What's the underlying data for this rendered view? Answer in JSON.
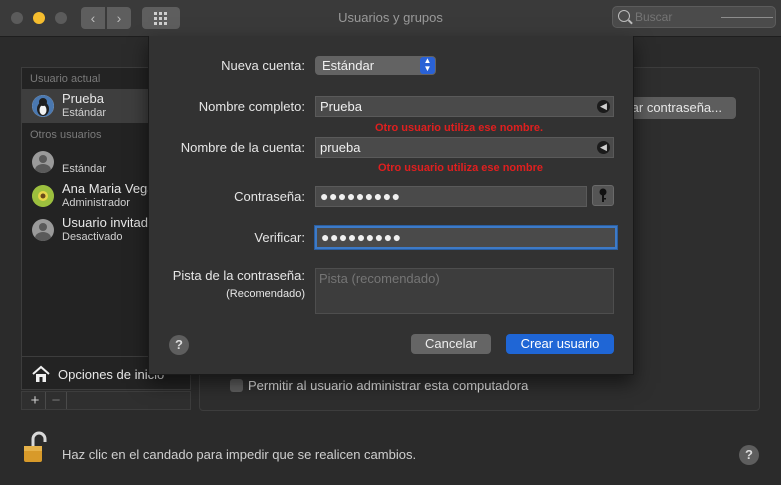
{
  "window": {
    "title": "Usuarios y grupos"
  },
  "search": {
    "placeholder": "Buscar"
  },
  "sidebar": {
    "current_user_header": "Usuario actual",
    "other_users_header": "Otros usuarios",
    "current_user": {
      "name": "Prueba",
      "role": "Estándar"
    },
    "others": [
      {
        "name": "",
        "role": "Estándar"
      },
      {
        "name": "Ana Maria Vega",
        "role": "Administrador"
      },
      {
        "name": "Usuario invitado",
        "role": "Desactivado"
      }
    ],
    "login_options": "Opciones de inicio"
  },
  "panel": {
    "change_password": "Cambiar contraseña...",
    "allow_admin": "Permitir al usuario administrar esta computadora"
  },
  "footer": {
    "lock_text": "Haz clic en el candado para impedir que se realicen cambios."
  },
  "sheet": {
    "new_account_label": "Nueva cuenta:",
    "new_account_value": "Estándar",
    "full_name_label": "Nombre completo:",
    "full_name_value": "Prueba",
    "full_name_error": "Otro usuario utiliza ese nombre.",
    "account_name_label": "Nombre de la cuenta:",
    "account_name_value": "prueba",
    "account_name_error": "Otro usuario utiliza ese nombre",
    "password_label": "Contraseña:",
    "password_dots": "●●●●●●●●●",
    "verify_label": "Verificar:",
    "verify_dots": "●●●●●●●●●",
    "hint_label": "Pista de la contraseña:",
    "hint_sublabel": "(Recomendado)",
    "hint_placeholder": "Pista (recomendado)",
    "cancel": "Cancelar",
    "create": "Crear usuario",
    "help": "?"
  },
  "help_main": "?",
  "colors": {
    "accent": "#1f66d6",
    "error": "#e01f1f",
    "focus": "#3d7ac7",
    "minimize": "#f5bd2e"
  }
}
